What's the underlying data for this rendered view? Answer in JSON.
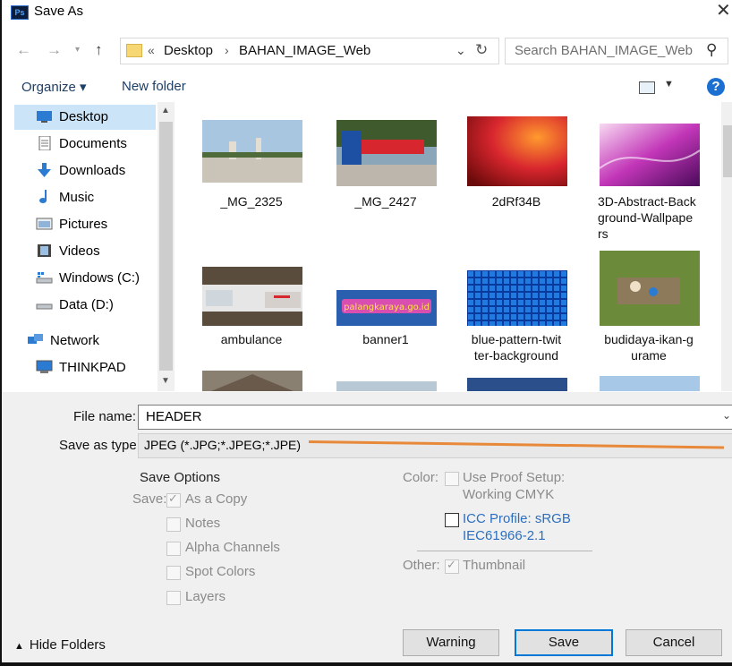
{
  "window": {
    "title": "Save As",
    "app_icon": "Ps"
  },
  "address": {
    "prefix": "«",
    "crumbs": [
      "Desktop",
      "BAHAN_IMAGE_Web"
    ],
    "separator": "›",
    "search_placeholder": "Search BAHAN_IMAGE_Web"
  },
  "toolbar": {
    "organize": "Organize ▾",
    "new_folder": "New folder",
    "help": "?"
  },
  "sidebar": {
    "items": [
      {
        "label": "Desktop",
        "icon": "desktop-icon",
        "selected": true
      },
      {
        "label": "Documents",
        "icon": "documents-icon"
      },
      {
        "label": "Downloads",
        "icon": "downloads-icon"
      },
      {
        "label": "Music",
        "icon": "music-icon"
      },
      {
        "label": "Pictures",
        "icon": "pictures-icon"
      },
      {
        "label": "Videos",
        "icon": "videos-icon"
      },
      {
        "label": "Windows (C:)",
        "icon": "drive-c-icon"
      },
      {
        "label": "Data (D:)",
        "icon": "drive-d-icon"
      },
      {
        "label": "Network",
        "icon": "network-icon"
      },
      {
        "label": "THINKPAD",
        "icon": "computer-icon"
      }
    ]
  },
  "files": [
    {
      "name": "_MG_2325"
    },
    {
      "name": "_MG_2427"
    },
    {
      "name": "2dRf34B"
    },
    {
      "name": "3D-Abstract-Back",
      "name2": "ground-Wallpape",
      "name3": "rs"
    },
    {
      "name": "ambulance"
    },
    {
      "name": "banner1",
      "thumb_text": "palangkaraya.go.id"
    },
    {
      "name": "blue-pattern-twit",
      "name2": "ter-background"
    },
    {
      "name": "budidaya-ikan-g",
      "name2": "urame"
    }
  ],
  "form": {
    "file_name_label": "File name:",
    "file_name_value": "HEADER",
    "save_type_label": "Save as type:",
    "save_type_value": "JPEG (*.JPG;*.JPEG;*.JPE)"
  },
  "save_options": {
    "heading": "Save Options",
    "save_label": "Save:",
    "as_a_copy": "As a Copy",
    "notes": "Notes",
    "alpha_channels": "Alpha Channels",
    "spot_colors": "Spot Colors",
    "layers": "Layers",
    "color_label": "Color:",
    "proof_line1": "Use Proof Setup:",
    "proof_line2": "Working CMYK",
    "icc_line1": "ICC Profile:  sRGB",
    "icc_line2": "IEC61966-2.1",
    "other_label": "Other:",
    "thumbnail": "Thumbnail"
  },
  "footer": {
    "hide_folders": "Hide Folders",
    "warning": "Warning",
    "save": "Save",
    "cancel": "Cancel"
  },
  "colors": {
    "accent": "#0078d7",
    "selection": "#cce4f7",
    "link": "#2c6fbf",
    "annotation": "#e8893a"
  }
}
